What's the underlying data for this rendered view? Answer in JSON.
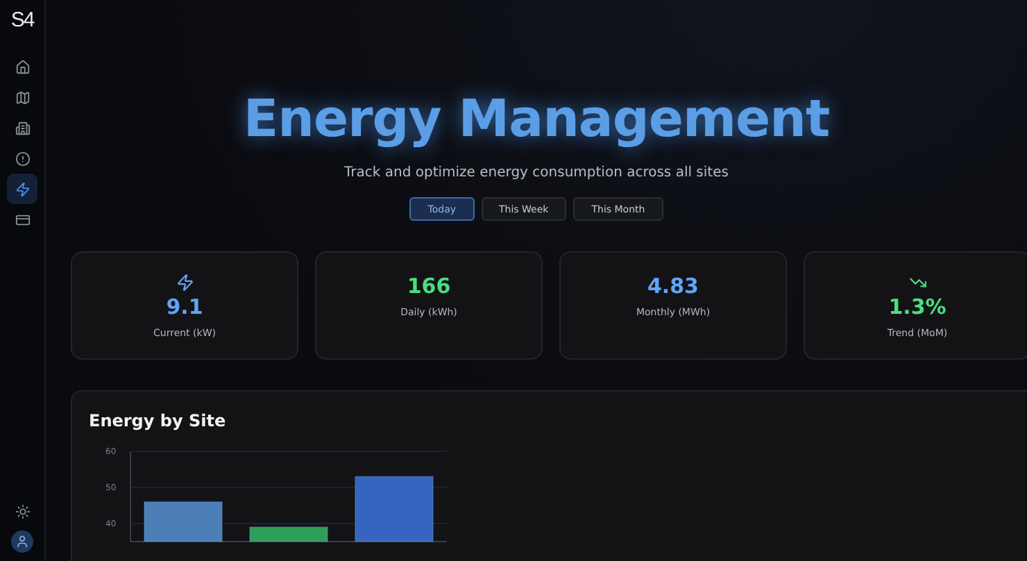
{
  "logo": "S4",
  "nav": [
    {
      "kind": "home",
      "selected": false
    },
    {
      "kind": "map",
      "selected": false
    },
    {
      "kind": "building",
      "selected": false
    },
    {
      "kind": "alert",
      "selected": false
    },
    {
      "kind": "energy",
      "selected": true
    },
    {
      "kind": "card",
      "selected": false
    }
  ],
  "header": {
    "title": "Energy Management",
    "subtitle": "Track and optimize energy consumption across all sites"
  },
  "tabs": [
    {
      "label": "Today",
      "selected": true
    },
    {
      "label": "This Week",
      "selected": false
    },
    {
      "label": "This Month",
      "selected": false
    }
  ],
  "stats": [
    {
      "kind": "icon-zap",
      "value": "9.1",
      "label": "Current (kW)",
      "color": "#60a5fa"
    },
    {
      "kind": "plain",
      "value": "166",
      "label": "Daily (kWh)",
      "color": "#4ade80"
    },
    {
      "kind": "plain",
      "value": "4.83",
      "label": "Monthly (MWh)",
      "color": "#60a5fa"
    },
    {
      "kind": "icon-trend",
      "value": "1.3%",
      "label": "Trend (MoM)",
      "color": "#4ade80"
    }
  ],
  "chart_panel": {
    "title": "Energy by Site",
    "chart_data": {
      "type": "bar",
      "values": [
        46,
        39,
        53
      ],
      "ylim": [
        35,
        60
      ],
      "yticks": [
        40,
        50,
        60
      ]
    }
  }
}
